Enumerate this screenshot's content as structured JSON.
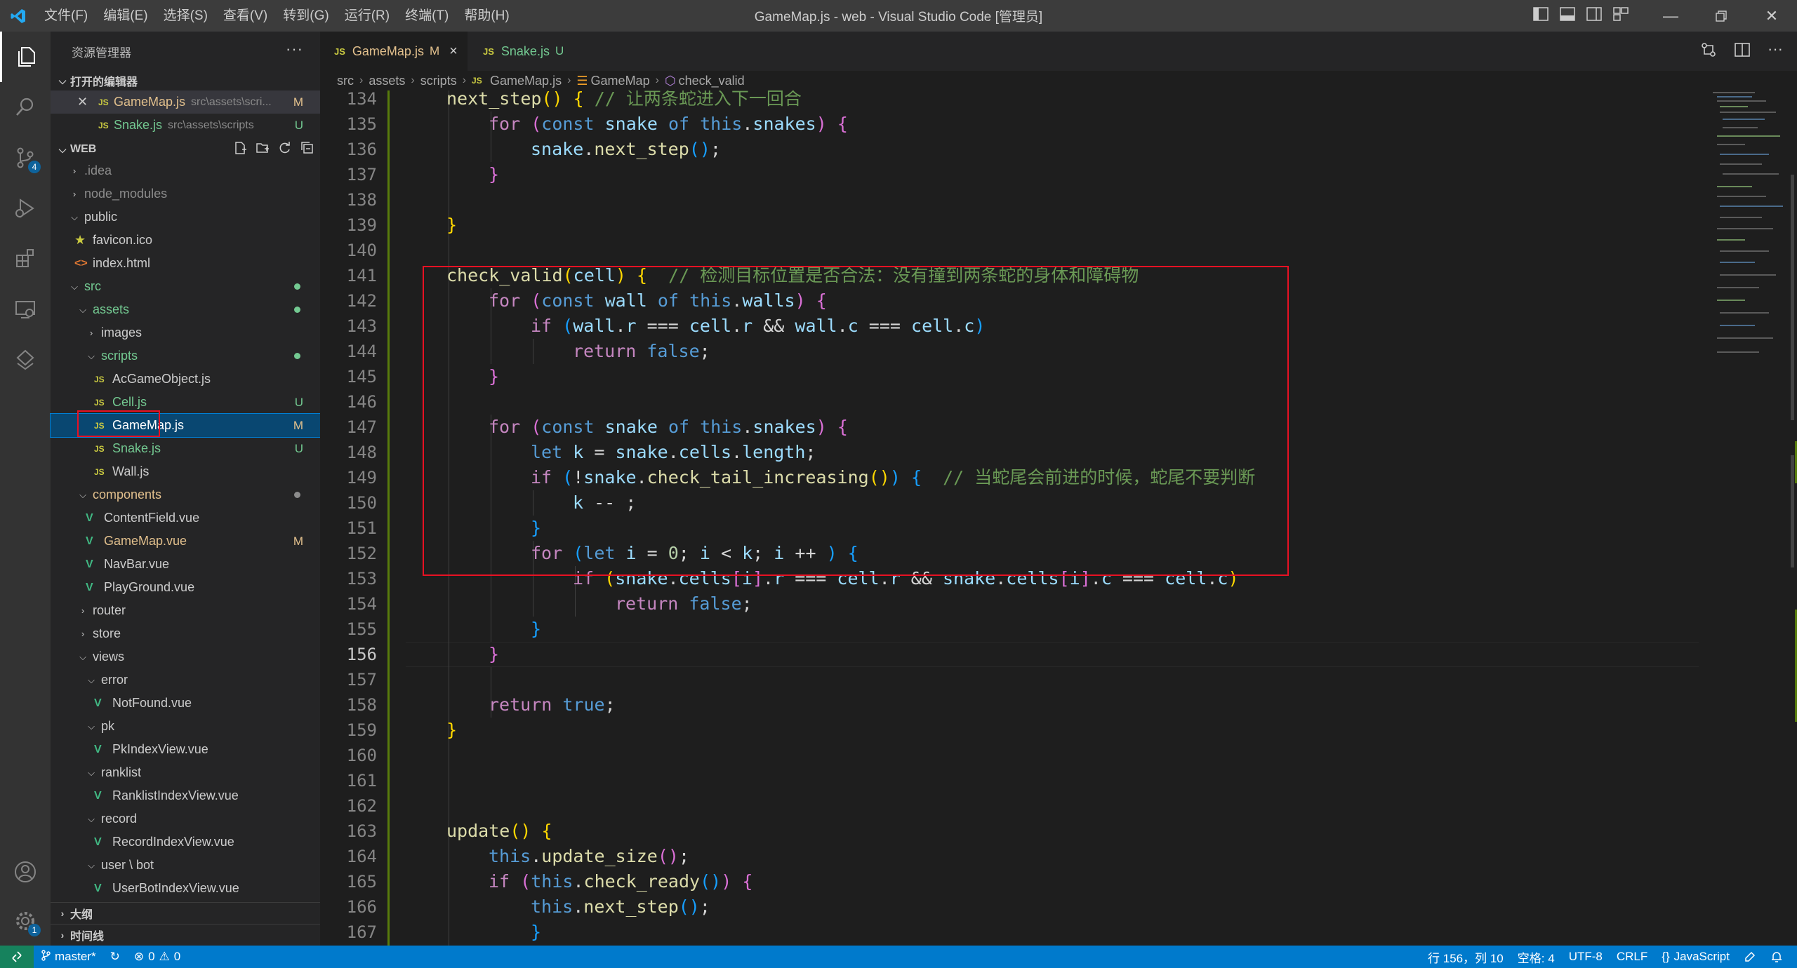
{
  "window": {
    "title": "GameMap.js - web - Visual Studio Code [管理员]",
    "menu": [
      "文件(F)",
      "编辑(E)",
      "选择(S)",
      "查看(V)",
      "转到(G)",
      "运行(R)",
      "终端(T)",
      "帮助(H)"
    ]
  },
  "activity": {
    "scm_badge": "4",
    "settings_badge": "1"
  },
  "sidebar": {
    "title": "资源管理器",
    "open_editors_header": "打开的编辑器",
    "open_editors": [
      {
        "name": "GameMap.js",
        "path": "src\\assets\\scri...",
        "status": "M"
      },
      {
        "name": "Snake.js",
        "path": "src\\assets\\scripts",
        "status": "U"
      }
    ],
    "workspace_header": "WEB",
    "tree": [
      {
        "label": ".idea",
        "status": ""
      },
      {
        "label": "node_modules",
        "status": ""
      },
      {
        "label": "public",
        "status": ""
      },
      {
        "label": "favicon.ico",
        "status": ""
      },
      {
        "label": "index.html",
        "status": ""
      },
      {
        "label": "src",
        "status": ""
      },
      {
        "label": "assets",
        "status": ""
      },
      {
        "label": "images",
        "status": ""
      },
      {
        "label": "scripts",
        "status": ""
      },
      {
        "label": "AcGameObject.js",
        "status": ""
      },
      {
        "label": "Cell.js",
        "status": "U"
      },
      {
        "label": "GameMap.js",
        "status": "M"
      },
      {
        "label": "Snake.js",
        "status": "U"
      },
      {
        "label": "Wall.js",
        "status": ""
      },
      {
        "label": "components",
        "status": ""
      },
      {
        "label": "ContentField.vue",
        "status": ""
      },
      {
        "label": "GameMap.vue",
        "status": "M"
      },
      {
        "label": "NavBar.vue",
        "status": ""
      },
      {
        "label": "PlayGround.vue",
        "status": ""
      },
      {
        "label": "router",
        "status": ""
      },
      {
        "label": "store",
        "status": ""
      },
      {
        "label": "views",
        "status": ""
      },
      {
        "label": "error",
        "status": ""
      },
      {
        "label": "NotFound.vue",
        "status": ""
      },
      {
        "label": "pk",
        "status": ""
      },
      {
        "label": "PkIndexView.vue",
        "status": ""
      },
      {
        "label": "ranklist",
        "status": ""
      },
      {
        "label": "RanklistIndexView.vue",
        "status": ""
      },
      {
        "label": "record",
        "status": ""
      },
      {
        "label": "RecordIndexView.vue",
        "status": ""
      },
      {
        "label": "user \\ bot",
        "status": ""
      },
      {
        "label": "UserBotIndexView.vue",
        "status": ""
      }
    ],
    "outline_header": "大纲",
    "timeline_header": "时间线"
  },
  "tabs": [
    {
      "name": "GameMap.js",
      "status": "M",
      "close": "×"
    },
    {
      "name": "Snake.js",
      "status": "U"
    }
  ],
  "breadcrumb": [
    "src",
    "assets",
    "scripts",
    "GameMap.js",
    "GameMap",
    "check_valid"
  ],
  "editor": {
    "line_numbers": [
      "134",
      "135",
      "136",
      "137",
      "138",
      "139",
      "140",
      "141",
      "142",
      "143",
      "144",
      "145",
      "146",
      "147",
      "148",
      "149",
      "150",
      "151",
      "152",
      "153",
      "154",
      "155",
      "156",
      "157",
      "158",
      "159",
      "160",
      "161",
      "162",
      "163",
      "164",
      "165",
      "166",
      "167"
    ],
    "current_line": "156",
    "comments": {
      "c134": "// 让两条蛇进入下一回合",
      "c141": "// 检测目标位置是否合法：没有撞到两条蛇的身体和障碍物",
      "c149": "// 当蛇尾会前进的时候，蛇尾不要判断"
    }
  },
  "statusbar": {
    "branch": "master*",
    "errors": "0",
    "warnings": "0",
    "position": "行 156，列 10",
    "spaces": "空格: 4",
    "encoding": "UTF-8",
    "eol": "CRLF",
    "language": "JavaScript"
  }
}
